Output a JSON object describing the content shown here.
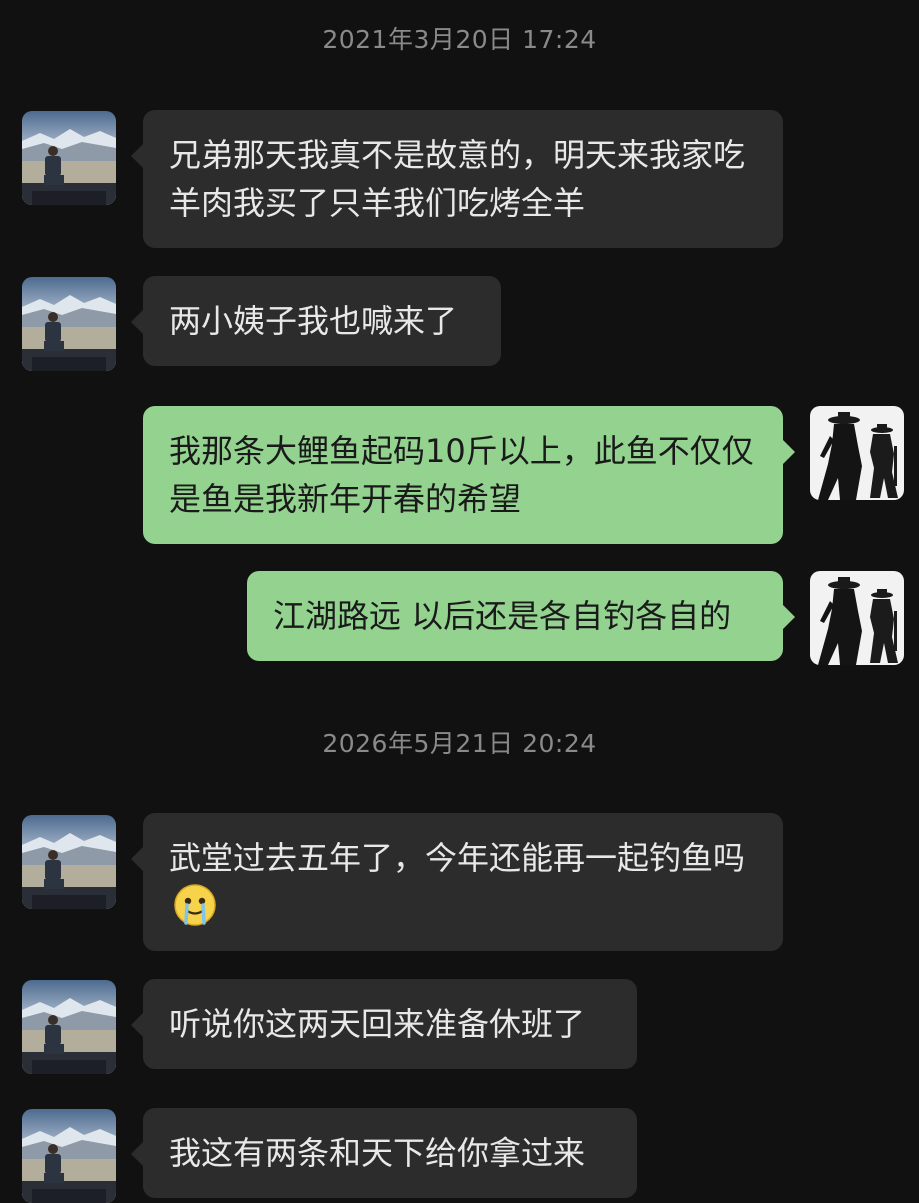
{
  "timestamps": [
    "2021年3月20日 17:24",
    "2026年5月21日 20:24"
  ],
  "messages": [
    {
      "from": "friend",
      "text": "兄弟那天我真不是故意的，明天来我家吃羊肉我买了只羊我们吃烤全羊"
    },
    {
      "from": "friend",
      "text": "两小姨子我也喊来了"
    },
    {
      "from": "me",
      "text": "我那条大鲤鱼起码10斤以上，此鱼不仅仅是鱼是我新年开春的希望"
    },
    {
      "from": "me",
      "text": "江湖路远 以后还是各自钓各自的"
    },
    {
      "from": "friend",
      "text": "武堂过去五年了，今年还能再一起钓鱼吗",
      "emoji": "crying-smile-emoji"
    },
    {
      "from": "friend",
      "text": "听说你这两天回来准备休班了"
    },
    {
      "from": "friend",
      "text": "我这有两条和天下给你拿过来"
    }
  ],
  "colors": {
    "background": "#111111",
    "incoming_bubble": "#2c2c2c",
    "outgoing_bubble": "#93d38f",
    "timestamp_text": "#8a8a8a"
  }
}
